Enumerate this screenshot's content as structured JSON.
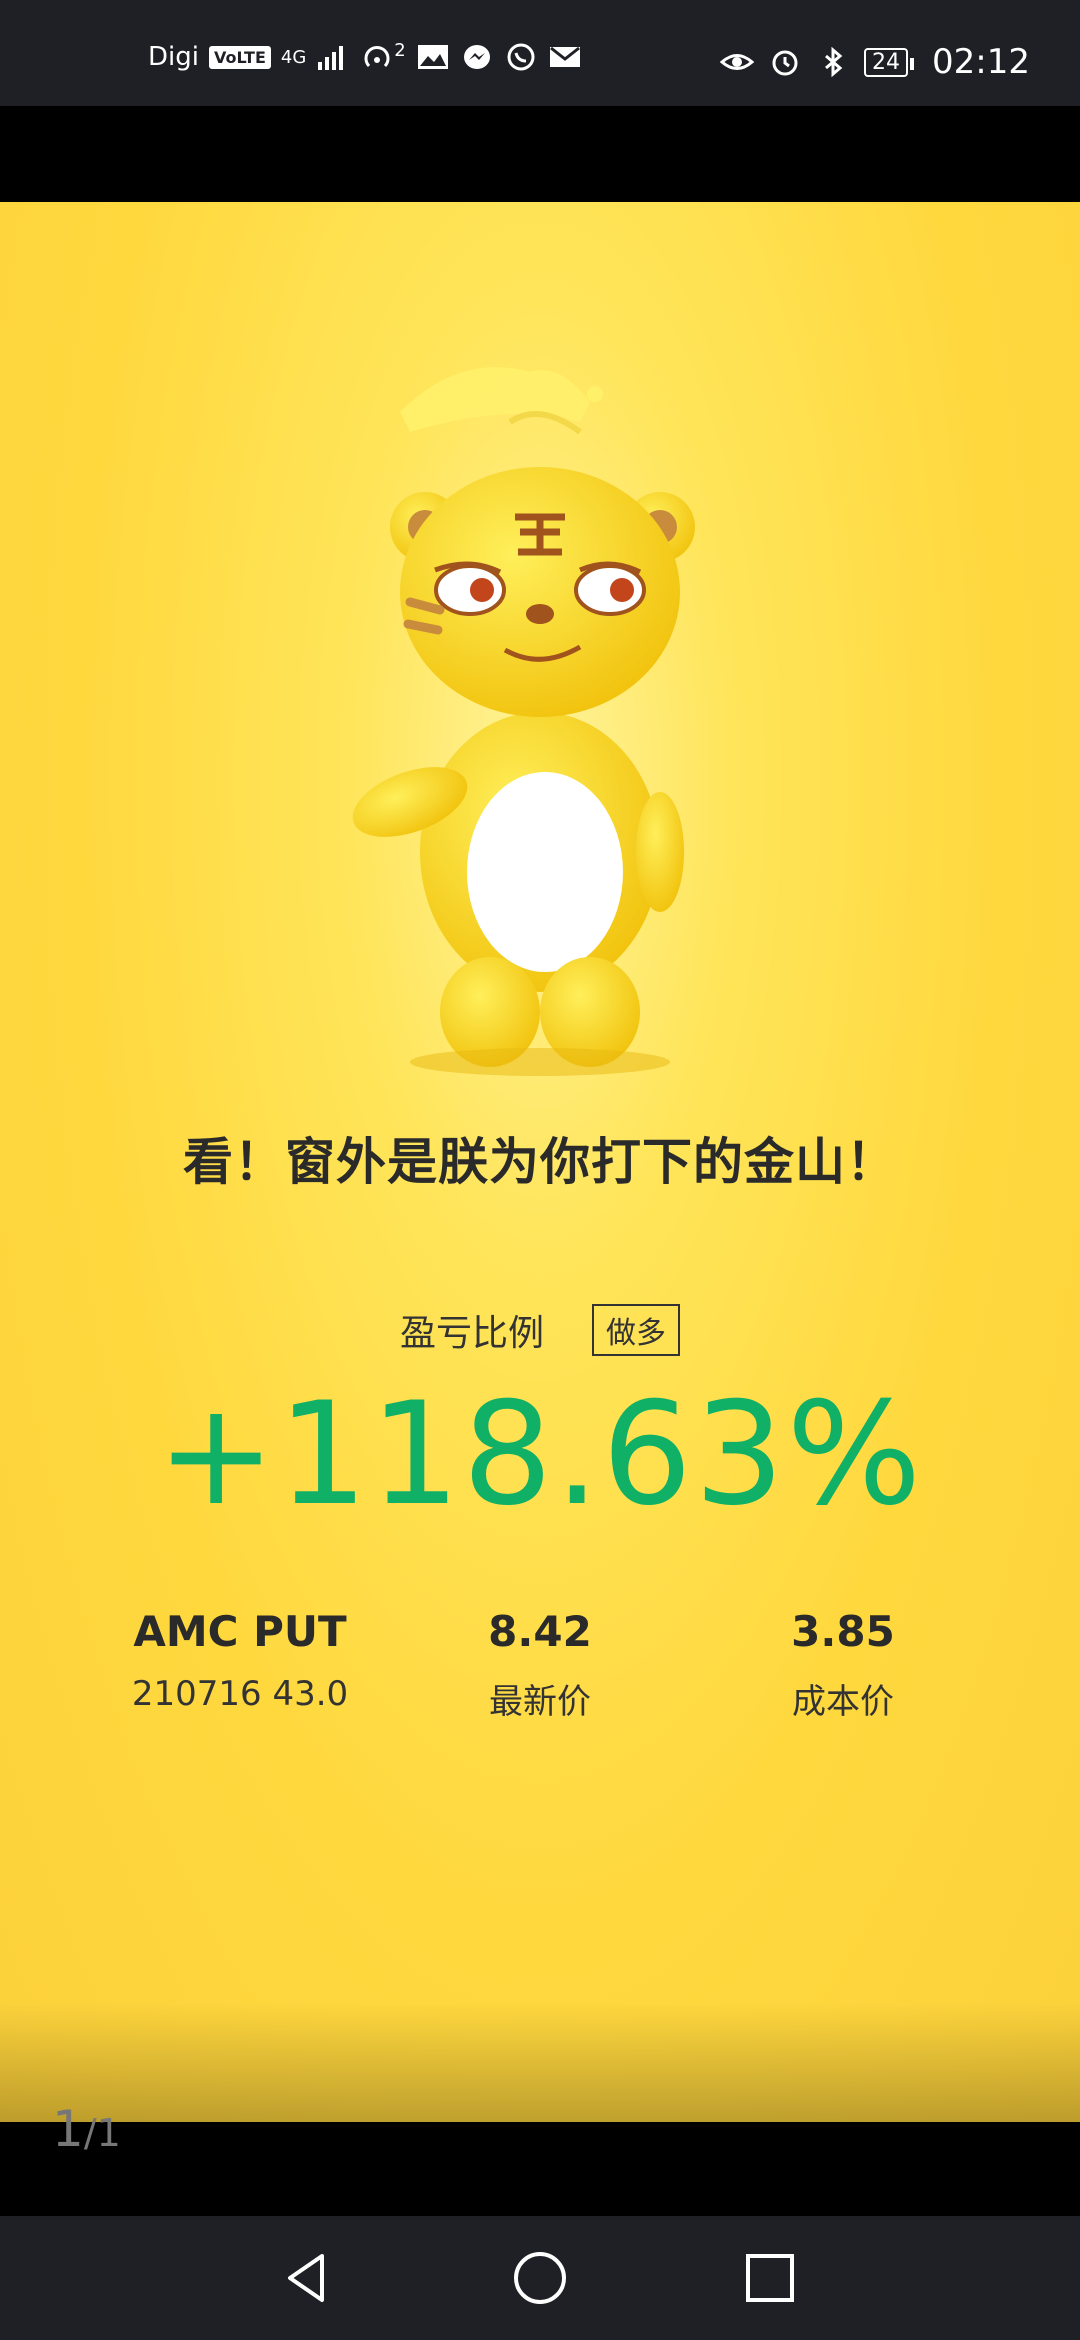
{
  "status_bar": {
    "carrier": "Digi",
    "volte_badge": "VoLTE",
    "network": "4G",
    "hotspot_count": "2",
    "battery": "24",
    "time": "02:12",
    "icons_left": [
      "signal-icon",
      "hotspot-icon",
      "gallery-icon",
      "messenger-icon",
      "whatsapp-icon",
      "mail-icon"
    ],
    "icons_right": [
      "eye-icon",
      "alarm-icon",
      "bluetooth-icon",
      "battery-icon"
    ]
  },
  "card": {
    "slogan": "看！窗外是朕为你打下的金山！",
    "ratio_label": "盈亏比例",
    "position_tag": "做多",
    "pnl_value": "+118.63%",
    "instrument": {
      "name": "AMC PUT",
      "contract": "210716 43.0"
    },
    "latest_price": {
      "value": "8.42",
      "label": "最新价"
    },
    "cost_price": {
      "value": "3.85",
      "label": "成本价"
    },
    "colors": {
      "background": "#ffd83e",
      "profit_green": "#10b066"
    }
  },
  "page_indicator": {
    "current": "1",
    "total": "/1"
  },
  "nav_bar": {
    "buttons": [
      "back-icon",
      "home-icon",
      "recents-icon"
    ]
  }
}
